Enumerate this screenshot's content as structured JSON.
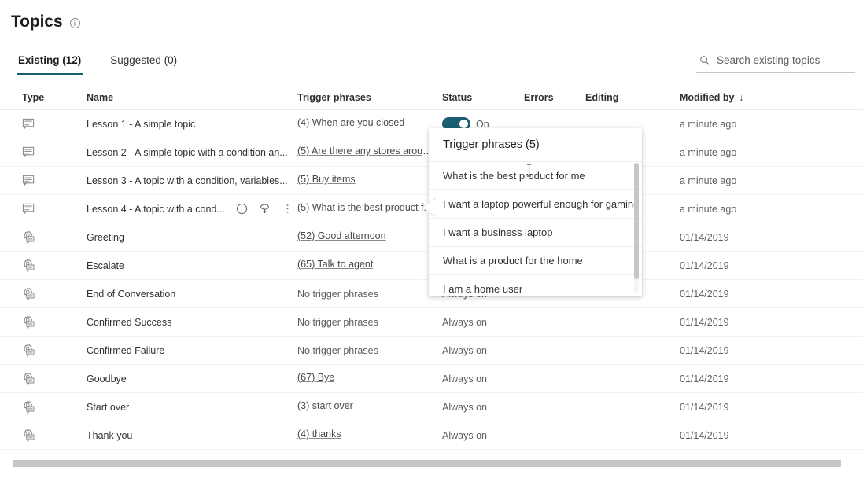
{
  "page": {
    "title": "Topics",
    "title_info_icon": "info-icon"
  },
  "tabs": [
    {
      "label": "Existing (12)",
      "active": true
    },
    {
      "label": "Suggested (0)",
      "active": false
    }
  ],
  "search": {
    "icon": "search-icon",
    "placeholder": "Search existing topics",
    "value": ""
  },
  "table": {
    "columns": [
      {
        "key": "type",
        "label": "Type"
      },
      {
        "key": "name",
        "label": "Name"
      },
      {
        "key": "trigger",
        "label": "Trigger phrases"
      },
      {
        "key": "status",
        "label": "Status"
      },
      {
        "key": "errors",
        "label": "Errors"
      },
      {
        "key": "editing",
        "label": "Editing"
      },
      {
        "key": "modified",
        "label": "Modified by"
      }
    ],
    "sorted_column": "Modified by",
    "sort_direction_glyph": "↓",
    "rows": [
      {
        "type_icon": "topic-icon",
        "name": "Lesson 1 - A simple topic",
        "trigger": "(4) When are you closed",
        "trigger_is_link": true,
        "status": "On",
        "status_toggle": true,
        "errors": "",
        "editing": "",
        "modified": "a minute ago",
        "actions": []
      },
      {
        "type_icon": "topic-icon",
        "name": "Lesson 2 - A simple topic with a condition an...",
        "trigger": "(5) Are there any stores aroun...",
        "trigger_is_link": true,
        "status": "",
        "status_toggle": false,
        "errors": "",
        "editing": "",
        "modified": "a minute ago",
        "actions": []
      },
      {
        "type_icon": "topic-icon",
        "name": "Lesson 3 - A topic with a condition, variables...",
        "trigger": "(5) Buy items",
        "trigger_is_link": true,
        "status": "",
        "status_toggle": false,
        "errors": "",
        "editing": "",
        "modified": "a minute ago",
        "actions": []
      },
      {
        "type_icon": "topic-icon",
        "name": "Lesson 4 - A topic with a cond...",
        "trigger": "(5) What is the best product f...",
        "trigger_is_link": true,
        "status": "",
        "status_toggle": false,
        "errors": "",
        "editing": "",
        "modified": "a minute ago",
        "actions": [
          "info-icon",
          "test-bot-icon",
          "more-options-icon"
        ]
      },
      {
        "type_icon": "system-topic-icon",
        "name": "Greeting",
        "trigger": "(52) Good afternoon",
        "trigger_is_link": true,
        "status": "Always on",
        "status_toggle": false,
        "errors": "",
        "editing": "",
        "modified": "01/14/2019",
        "actions": []
      },
      {
        "type_icon": "system-topic-icon",
        "name": "Escalate",
        "trigger": "(65) Talk to agent",
        "trigger_is_link": true,
        "status": "Always on",
        "status_toggle": false,
        "errors": "",
        "editing": "",
        "modified": "01/14/2019",
        "actions": []
      },
      {
        "type_icon": "system-topic-icon",
        "name": "End of Conversation",
        "trigger": "No trigger phrases",
        "trigger_is_link": false,
        "status": "Always on",
        "status_toggle": false,
        "errors": "",
        "editing": "",
        "modified": "01/14/2019",
        "actions": []
      },
      {
        "type_icon": "system-topic-icon",
        "name": "Confirmed Success",
        "trigger": "No trigger phrases",
        "trigger_is_link": false,
        "status": "Always on",
        "status_toggle": false,
        "errors": "",
        "editing": "",
        "modified": "01/14/2019",
        "actions": []
      },
      {
        "type_icon": "system-topic-icon",
        "name": "Confirmed Failure",
        "trigger": "No trigger phrases",
        "trigger_is_link": false,
        "status": "Always on",
        "status_toggle": false,
        "errors": "",
        "editing": "",
        "modified": "01/14/2019",
        "actions": []
      },
      {
        "type_icon": "system-topic-icon",
        "name": "Goodbye",
        "trigger": "(67) Bye",
        "trigger_is_link": true,
        "status": "Always on",
        "status_toggle": false,
        "errors": "",
        "editing": "",
        "modified": "01/14/2019",
        "actions": []
      },
      {
        "type_icon": "system-topic-icon",
        "name": "Start over",
        "trigger": "(3) start over",
        "trigger_is_link": true,
        "status": "Always on",
        "status_toggle": false,
        "errors": "",
        "editing": "",
        "modified": "01/14/2019",
        "actions": []
      },
      {
        "type_icon": "system-topic-icon",
        "name": "Thank you",
        "trigger": "(4) thanks",
        "trigger_is_link": true,
        "status": "Always on",
        "status_toggle": false,
        "errors": "",
        "editing": "",
        "modified": "01/14/2019",
        "actions": []
      }
    ]
  },
  "callout": {
    "header": "Trigger phrases (5)",
    "items": [
      "What is the best product for me",
      "I want a laptop powerful enough for gaming",
      "I want a business laptop",
      "What is a product for the home",
      "I am a home user"
    ]
  },
  "colors": {
    "accent": "#1b5e72",
    "text_primary": "#201f1e",
    "text_secondary": "#605e5c",
    "row_divider": "#f3f2f1",
    "scrollbar": "#c8c6c4"
  }
}
